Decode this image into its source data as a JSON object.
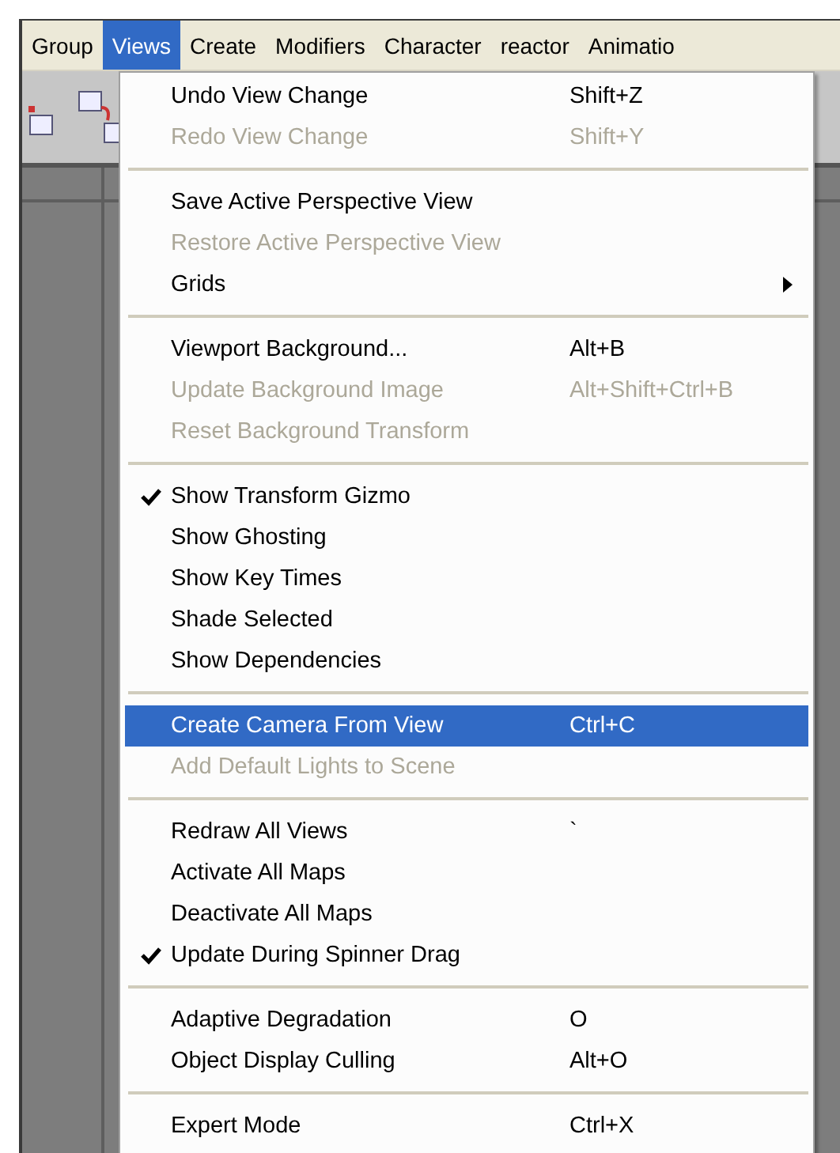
{
  "menubar": [
    {
      "label": "Group",
      "selected": false
    },
    {
      "label": "Views",
      "selected": true
    },
    {
      "label": "Create",
      "selected": false
    },
    {
      "label": "Modifiers",
      "selected": false
    },
    {
      "label": "Character",
      "selected": false
    },
    {
      "label": "reactor",
      "selected": false
    },
    {
      "label": "Animatio",
      "selected": false
    }
  ],
  "menu": {
    "groups": [
      {
        "items": [
          {
            "label": "Undo View Change",
            "shortcut": "Shift+Z",
            "disabled": false,
            "checked": false,
            "selected": false
          },
          {
            "label": "Redo View Change",
            "shortcut": "Shift+Y",
            "disabled": true,
            "checked": false,
            "selected": false
          }
        ]
      },
      {
        "items": [
          {
            "label": "Save Active Perspective View",
            "disabled": false,
            "checked": false,
            "selected": false
          },
          {
            "label": "Restore Active Perspective View",
            "disabled": true,
            "checked": false,
            "selected": false
          },
          {
            "label": "Grids",
            "disabled": false,
            "checked": false,
            "selected": false,
            "submenu": true
          }
        ]
      },
      {
        "items": [
          {
            "label": "Viewport Background...",
            "shortcut": "Alt+B",
            "disabled": false,
            "checked": false,
            "selected": false
          },
          {
            "label": "Update Background Image",
            "shortcut": "Alt+Shift+Ctrl+B",
            "disabled": true,
            "checked": false,
            "selected": false
          },
          {
            "label": "Reset Background Transform",
            "disabled": true,
            "checked": false,
            "selected": false
          }
        ]
      },
      {
        "items": [
          {
            "label": "Show Transform Gizmo",
            "disabled": false,
            "checked": true,
            "selected": false
          },
          {
            "label": "Show Ghosting",
            "disabled": false,
            "checked": false,
            "selected": false
          },
          {
            "label": "Show Key Times",
            "disabled": false,
            "checked": false,
            "selected": false
          },
          {
            "label": "Shade Selected",
            "disabled": false,
            "checked": false,
            "selected": false
          },
          {
            "label": "Show Dependencies",
            "disabled": false,
            "checked": false,
            "selected": false
          }
        ]
      },
      {
        "items": [
          {
            "label": "Create Camera From View",
            "shortcut": "Ctrl+C",
            "disabled": false,
            "checked": false,
            "selected": true
          },
          {
            "label": "Add Default Lights to Scene",
            "disabled": true,
            "checked": false,
            "selected": false
          }
        ]
      },
      {
        "items": [
          {
            "label": "Redraw All Views",
            "shortcut": "`",
            "disabled": false,
            "checked": false,
            "selected": false
          },
          {
            "label": "Activate All Maps",
            "disabled": false,
            "checked": false,
            "selected": false
          },
          {
            "label": "Deactivate All Maps",
            "disabled": false,
            "checked": false,
            "selected": false
          },
          {
            "label": "Update During Spinner Drag",
            "disabled": false,
            "checked": true,
            "selected": false
          }
        ]
      },
      {
        "items": [
          {
            "label": "Adaptive Degradation",
            "shortcut": "O",
            "disabled": false,
            "checked": false,
            "selected": false
          },
          {
            "label": "Object Display Culling",
            "shortcut": "Alt+O",
            "disabled": false,
            "checked": false,
            "selected": false
          }
        ]
      },
      {
        "items": [
          {
            "label": "Expert Mode",
            "shortcut": "Ctrl+X",
            "disabled": false,
            "checked": false,
            "selected": false
          }
        ]
      }
    ]
  }
}
